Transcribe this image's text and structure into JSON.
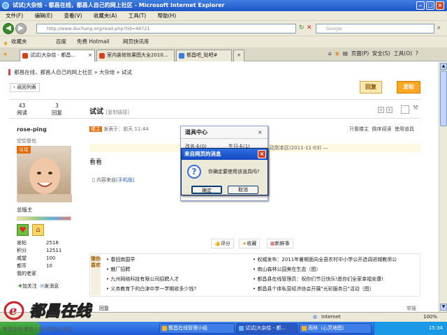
{
  "window": {
    "title": "试试|大杂烩 - 都昌在线，都昌人自己的网上社区 - Microsoft Internet Explorer"
  },
  "menu": [
    "文件(F)",
    "编辑(E)",
    "查看(V)",
    "收藏夹(A)",
    "工具(T)",
    "帮助(H)"
  ],
  "address": {
    "url": "http://www.duchang.org/read.php?tid=48721"
  },
  "search": {
    "placeholder": "Google"
  },
  "favorites_bar": {
    "favorites": "收藏夹",
    "baidu": "百度",
    "hotmail": "免费 Hotmail",
    "gallery": "网页快讯库"
  },
  "tabs": [
    {
      "label": "试试|大杂烩 - 都昌..."
    },
    {
      "label": "室内装修效果图大全2010..."
    },
    {
      "label": "都昌吧_贴吧#"
    }
  ],
  "toolbar_right": {
    "page": "页面(P)",
    "safety": "安全(S)",
    "tools": "工具(O)"
  },
  "breadcrumb": {
    "site": "都昌在线，都昌人自己的网上社区",
    "forum": "大杂烩",
    "thread": "试试"
  },
  "back_label": "返回列表",
  "reply_label": "回复",
  "post_label": "发帖",
  "stats": {
    "views": "43",
    "views_label": "阅读",
    "replies": "3",
    "replies_label": "回复"
  },
  "thread": {
    "title": "试试",
    "copy_link": "[复制链接]"
  },
  "post_meta": {
    "author_tag": "楼主",
    "posted": "发表于：前天 11:44",
    "only_author": "只看楼主",
    "reverse": "倒序阅读",
    "use_tool": "使用道具"
  },
  "notice": "动到本区(2011-11-03) —",
  "post_body": "看看",
  "mobile_source": {
    "prefix": "内容来自",
    "link": "[手机版]"
  },
  "user": {
    "name": "rose-ping",
    "title": "空空是也",
    "auth_badge": "认证",
    "rank": "总版主",
    "stats": [
      {
        "label": "发帖",
        "value": "2518"
      },
      {
        "label": "积分",
        "value": "12511"
      },
      {
        "label": "威望",
        "value": "100"
      },
      {
        "label": "都币",
        "value": "10"
      }
    ],
    "my_lord": "我的老家",
    "add_follow": "加关注",
    "send_message": "发消息"
  },
  "post_actions": {
    "rate": "评分",
    "favorite": "收藏",
    "new_post": "新鲜事"
  },
  "guess_label": "猜你喜欢",
  "recommend_left": [
    "春回南国早",
    "魅厂招聘",
    "九州网络科技有限公司招聘人才",
    "义务教育下的白津中学一学期收多少钱?"
  ],
  "recommend_right": [
    "权威发布：2011年暑期面向全县农村中小学公开选调进城教师公",
    "南山森林公园美在生态（图）",
    "都昌县在线管理员：祝你们节日快乐!愿你们全家幸福安康!",
    "都昌县个体私营经济协会开展\"光彩服务日\"活动（图）"
  ],
  "reply_footer": {
    "left": "回复",
    "right": "举报"
  },
  "tool_dialog": {
    "title": "道具中心",
    "close": "×",
    "col1": "改名卡(0)",
    "col2": "生日卡(1)"
  },
  "alert": {
    "title": "来自网页的消息",
    "message": "你确定要使用该道具吗?",
    "ok": "确定",
    "cancel": "取消"
  },
  "status": {
    "zone": "Internet",
    "zoom": "100%"
  },
  "watermark": {
    "logo": "都昌在线",
    "sub": "都昌在线·都昌人自己的网上社区"
  },
  "taskbar": {
    "items": [
      "都昌在线管理小组",
      "试试|大杂烩 - 都...",
      "雨林（心灵地图）"
    ],
    "clock": "15:34"
  },
  "colors": {
    "accent": "#e26b0a",
    "title_blue": "#1d54c8",
    "taskbar_blue": "#2a66e0"
  }
}
